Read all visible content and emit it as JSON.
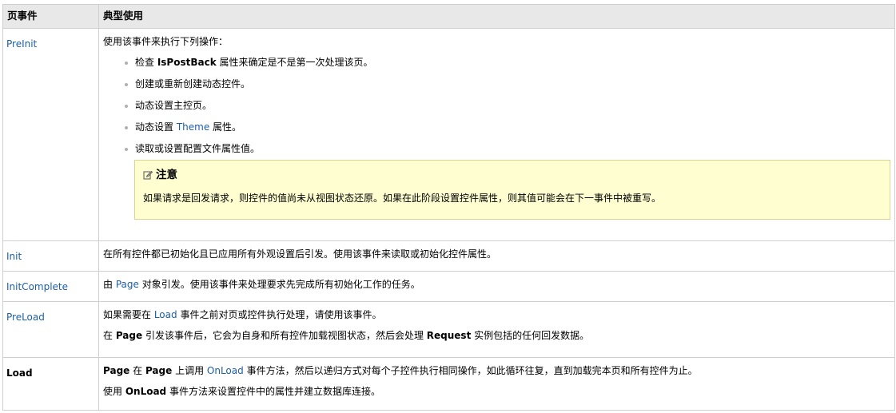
{
  "table": {
    "headers": [
      "页事件",
      "典型使用"
    ],
    "rows": {
      "preinit": {
        "event": "PreInit",
        "intro": "使用该事件来执行下列操作：",
        "items": {
          "check": {
            "pre": "检查 ",
            "bold": "IsPostBack",
            "post": " 属性来确定是不是第一次处理该页。"
          },
          "create": "创建或重新创建动态控件。",
          "master": "动态设置主控页。",
          "theme": {
            "pre": "动态设置 ",
            "link": "Theme",
            "post": " 属性。"
          },
          "profile": "读取或设置配置文件属性值。"
        },
        "note": {
          "title": "注意",
          "icon": "note-pencil-icon",
          "text": "如果请求是回发请求，则控件的值尚未从视图状态还原。如果在此阶段设置控件属性，则其值可能会在下一事件中被重写。"
        }
      },
      "init": {
        "event": "Init",
        "text": "在所有控件都已初始化且已应用所有外观设置后引发。使用该事件来读取或初始化控件属性。"
      },
      "initcomplete": {
        "event": "InitComplete",
        "pre": "由 ",
        "link": "Page",
        "post": " 对象引发。使用该事件来处理要求先完成所有初始化工作的任务。"
      },
      "preload": {
        "event": "PreLoad",
        "p1": {
          "pre": "如果需要在 ",
          "link": "Load",
          "post": " 事件之前对页或控件执行处理，请使用该事件。"
        },
        "p2": {
          "pre": "在 ",
          "b1": "Page",
          "mid": " 引发该事件后，它会为自身和所有控件加载视图状态，然后会处理 ",
          "b2": "Request",
          "post": " 实例包括的任何回发数据。"
        }
      },
      "load": {
        "event": "Load",
        "p1": {
          "b1": "Page",
          "t1": " 在 ",
          "b2": "Page",
          "t2": " 上调用 ",
          "link": "OnLoad",
          "post": " 事件方法，然后以递归方式对每个子控件执行相同操作，如此循环往复，直到加载完本页和所有控件为止。"
        },
        "p2": {
          "pre": "使用 ",
          "bold": "OnLoad",
          "post": " 事件方法来设置控件中的属性并建立数据库连接。"
        }
      }
    }
  },
  "colors": {
    "link": "#1c5fa8",
    "header_bg": "#e8e8e8",
    "note_bg": "#fffed0",
    "border": "#cfcfcf"
  }
}
